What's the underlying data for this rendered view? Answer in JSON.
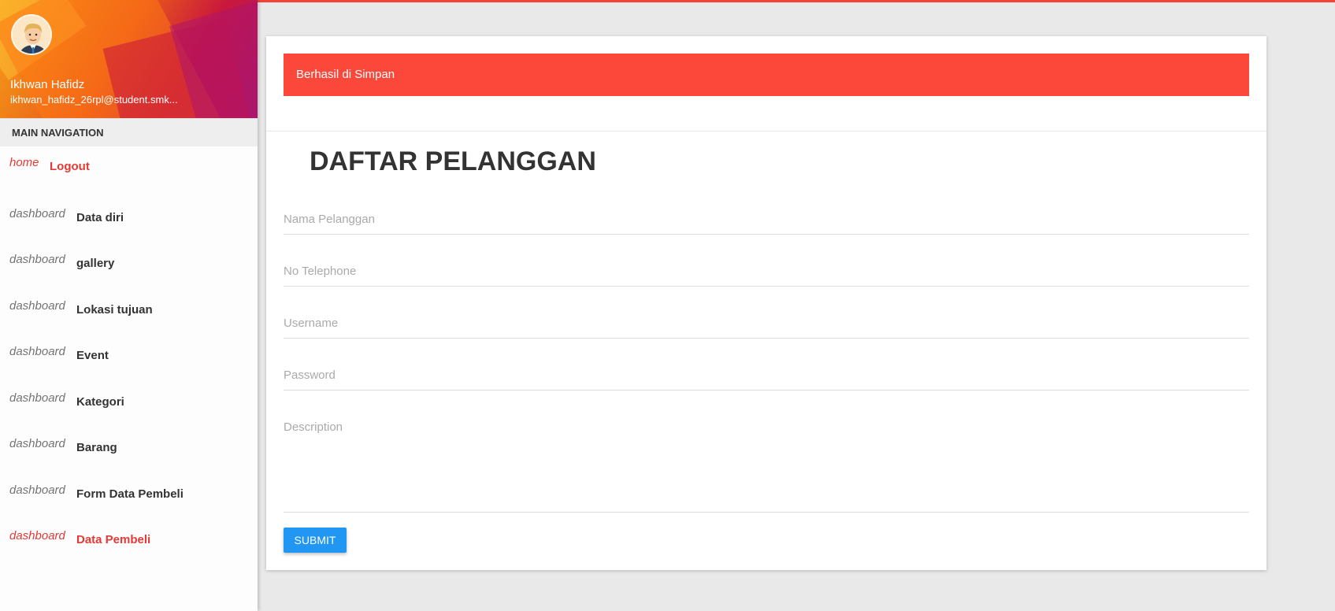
{
  "user": {
    "name": "Ikhwan Hafidz",
    "email": "ikhwan_hafidz_26rpl@student.smk..."
  },
  "nav": {
    "header": "MAIN NAVIGATION",
    "items": [
      {
        "icon": "home",
        "label": "Logout"
      },
      {
        "icon": "dashboard",
        "label": "Data diri"
      },
      {
        "icon": "dashboard",
        "label": "gallery"
      },
      {
        "icon": "dashboard",
        "label": "Lokasi tujuan"
      },
      {
        "icon": "dashboard",
        "label": "Event"
      },
      {
        "icon": "dashboard",
        "label": "Kategori"
      },
      {
        "icon": "dashboard",
        "label": "Barang"
      },
      {
        "icon": "dashboard",
        "label": "Form Data Pembeli"
      },
      {
        "icon": "dashboard",
        "label": "Data Pembeli"
      }
    ],
    "active_label": "Data Pembeli"
  },
  "alert": {
    "message": "Berhasil di Simpan",
    "color": "#fb483a"
  },
  "form": {
    "title": "DAFTAR PELANGGAN",
    "fields": [
      {
        "placeholder": "Nama Pelanggan",
        "value": ""
      },
      {
        "placeholder": "No Telephone",
        "value": ""
      },
      {
        "placeholder": "Username",
        "value": ""
      },
      {
        "placeholder": "Password",
        "value": ""
      },
      {
        "placeholder": "Description",
        "value": ""
      }
    ],
    "submit_label": "SUBMIT",
    "submit_color": "#2196f3"
  },
  "colors": {
    "accent": "#f44336",
    "active_nav": "#e53935"
  }
}
